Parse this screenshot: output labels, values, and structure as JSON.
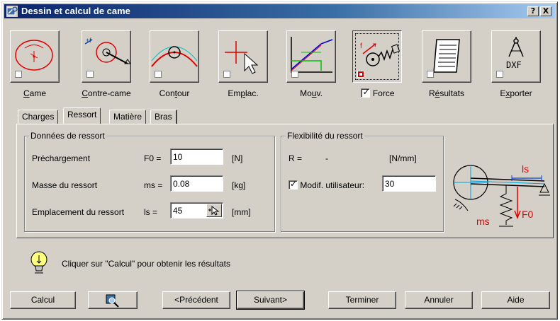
{
  "window": {
    "title": "Dessin et calcul de came",
    "help_btn": "?",
    "close_btn": "X"
  },
  "toolbar": [
    {
      "id": "came",
      "label_pre": "",
      "label_u": "C",
      "label_post": "ame"
    },
    {
      "id": "contre-came",
      "label_pre": "",
      "label_u": "C",
      "label_post": "ontre-came"
    },
    {
      "id": "contour",
      "label_pre": "Con",
      "label_u": "t",
      "label_post": "our"
    },
    {
      "id": "emplac",
      "label_pre": "Em",
      "label_u": "p",
      "label_post": "lac."
    },
    {
      "id": "mouv",
      "label_pre": "Mo",
      "label_u": "u",
      "label_post": "v."
    },
    {
      "id": "force",
      "label": "Force",
      "checked": true
    },
    {
      "id": "resultats",
      "label_pre": "R",
      "label_u": "é",
      "label_post": "sultats"
    },
    {
      "id": "exporter",
      "label_pre": "E",
      "label_u": "x",
      "label_post": "porter"
    }
  ],
  "export_icon_text": "DXF",
  "tabs": [
    "Charges",
    "Ressort",
    "Matière",
    "Bras"
  ],
  "active_tab": "Ressort",
  "spring_data": {
    "title": "Données de ressort",
    "rows": [
      {
        "label": "Préchargement",
        "symbol": "F0 =",
        "value": "10",
        "unit": "[N]"
      },
      {
        "label": "Masse du ressort",
        "symbol": "ms =",
        "value": "0.08",
        "unit": "[kg]"
      },
      {
        "label": "Emplacement du ressort",
        "symbol": "ls =",
        "value": "45",
        "unit": "[mm]"
      }
    ]
  },
  "flexibility": {
    "title": "Flexibilité du ressort",
    "r_label": "R =",
    "r_value": "-",
    "r_unit": "[N/mm]",
    "user_label": "Modif. utilisateur:",
    "user_checked": true,
    "user_value": "30"
  },
  "diagram": {
    "ls_label": "ls",
    "ms_label": "ms",
    "f0_label": "F0"
  },
  "hint": "Cliquer sur \"Calcul\" pour obtenir les résultats",
  "buttons": {
    "calcul": "Calcul",
    "precedent": "<Précédent",
    "suivant": "Suivant>",
    "terminer": "Terminer",
    "annuler": "Annuler",
    "aide": "Aide"
  }
}
